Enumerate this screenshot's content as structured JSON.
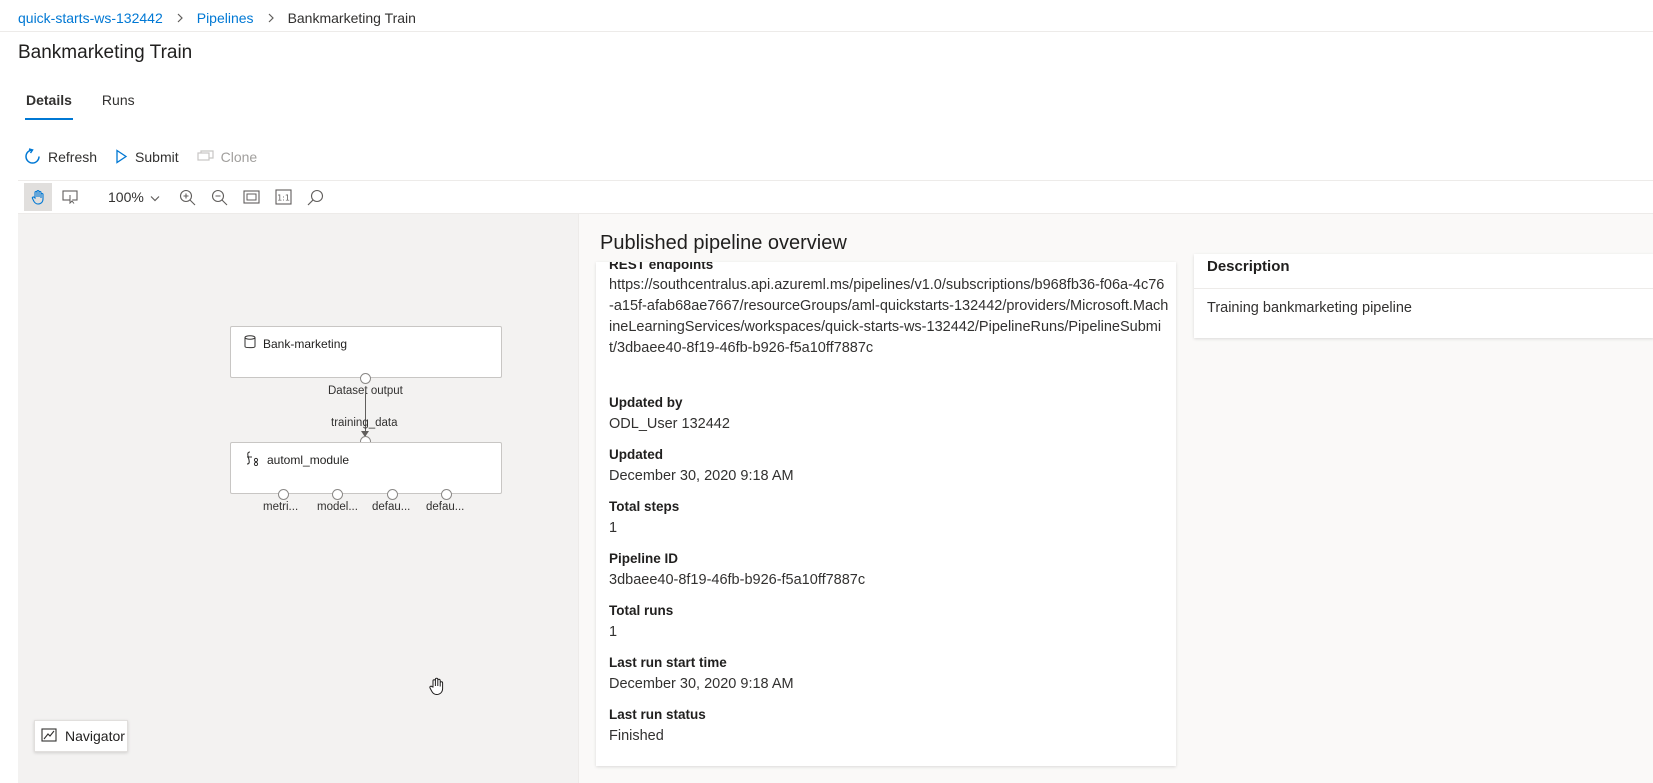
{
  "breadcrumb": {
    "workspace": "quick-starts-ws-132442",
    "pipelines": "Pipelines",
    "current": "Bankmarketing Train"
  },
  "page": {
    "title": "Bankmarketing Train"
  },
  "tabs": [
    {
      "label": "Details",
      "active": true
    },
    {
      "label": "Runs",
      "active": false
    }
  ],
  "commands": {
    "refresh": "Refresh",
    "submit": "Submit",
    "clone": "Clone"
  },
  "canvas_toolbar": {
    "zoom": "100%",
    "tools": [
      "pan-hand-icon",
      "select-icon",
      "zoom-in-icon",
      "zoom-out-icon",
      "fit-to-screen-icon",
      "actual-size-icon",
      "search-icon"
    ]
  },
  "graph": {
    "nodes": [
      {
        "name": "Bank-marketing",
        "icon": "dataset-icon",
        "outputs": [
          "Dataset output"
        ]
      },
      {
        "name": "automl_module",
        "icon": "module-icon",
        "inputs": [
          "training_data"
        ],
        "outputs": [
          "metri...",
          "model...",
          "defau...",
          "defau..."
        ]
      }
    ]
  },
  "navigator": {
    "label": "Navigator"
  },
  "overview": {
    "title": "Published pipeline overview",
    "rest_endpoint_label": "REST endpoints",
    "rest_endpoint_value": "https://southcentralus.api.azureml.ms/pipelines/v1.0/subscriptions/b968fb36-f06a-4c76-a15f-afab68ae7667/resourceGroups/aml-quickstarts-132442/providers/Microsoft.MachineLearningServices/workspaces/quick-starts-ws-132442/PipelineRuns/PipelineSubmit/3dbaee40-8f19-46fb-b926-f5a10ff7887c",
    "fields": [
      {
        "label": "Updated by",
        "value": "ODL_User 132442"
      },
      {
        "label": "Updated",
        "value": "December 30, 2020 9:18 AM"
      },
      {
        "label": "Total steps",
        "value": "1"
      },
      {
        "label": "Pipeline ID",
        "value": "3dbaee40-8f19-46fb-b926-f5a10ff7887c"
      },
      {
        "label": "Total runs",
        "value": "1"
      },
      {
        "label": "Last run start time",
        "value": "December 30, 2020 9:18 AM"
      },
      {
        "label": "Last run status",
        "value": "Finished"
      }
    ]
  },
  "description": {
    "header": "Description",
    "value": "Training bankmarketing pipeline"
  },
  "colors": {
    "accent": "#0078d4",
    "canvas_background": "#f3f2f1",
    "text": "#201f1e"
  }
}
